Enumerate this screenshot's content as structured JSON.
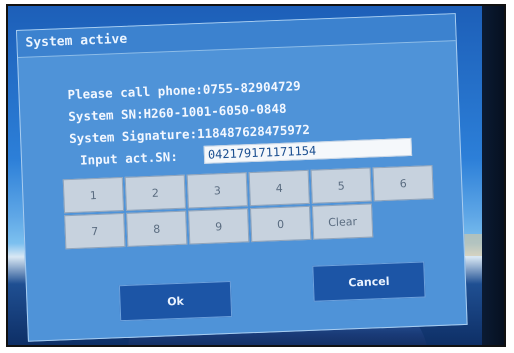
{
  "dialog": {
    "title": "System active",
    "phone_line": "Please call phone:0755-82904729",
    "sn_line": "System SN:H260-1001-6050-0848",
    "signature_line": "System Signature:118487628475972",
    "input_label": "Input act.SN:",
    "input_value": "042179171171154"
  },
  "keypad": {
    "keys": [
      "1",
      "2",
      "3",
      "4",
      "5",
      "6",
      "7",
      "8",
      "9",
      "0",
      "Clear"
    ]
  },
  "buttons": {
    "ok_label": "Ok",
    "cancel_label": "Cancel"
  },
  "colors": {
    "dialog_bg": "#4f93d8",
    "button_bg": "#1c55a6",
    "key_bg": "#c7d2de"
  }
}
